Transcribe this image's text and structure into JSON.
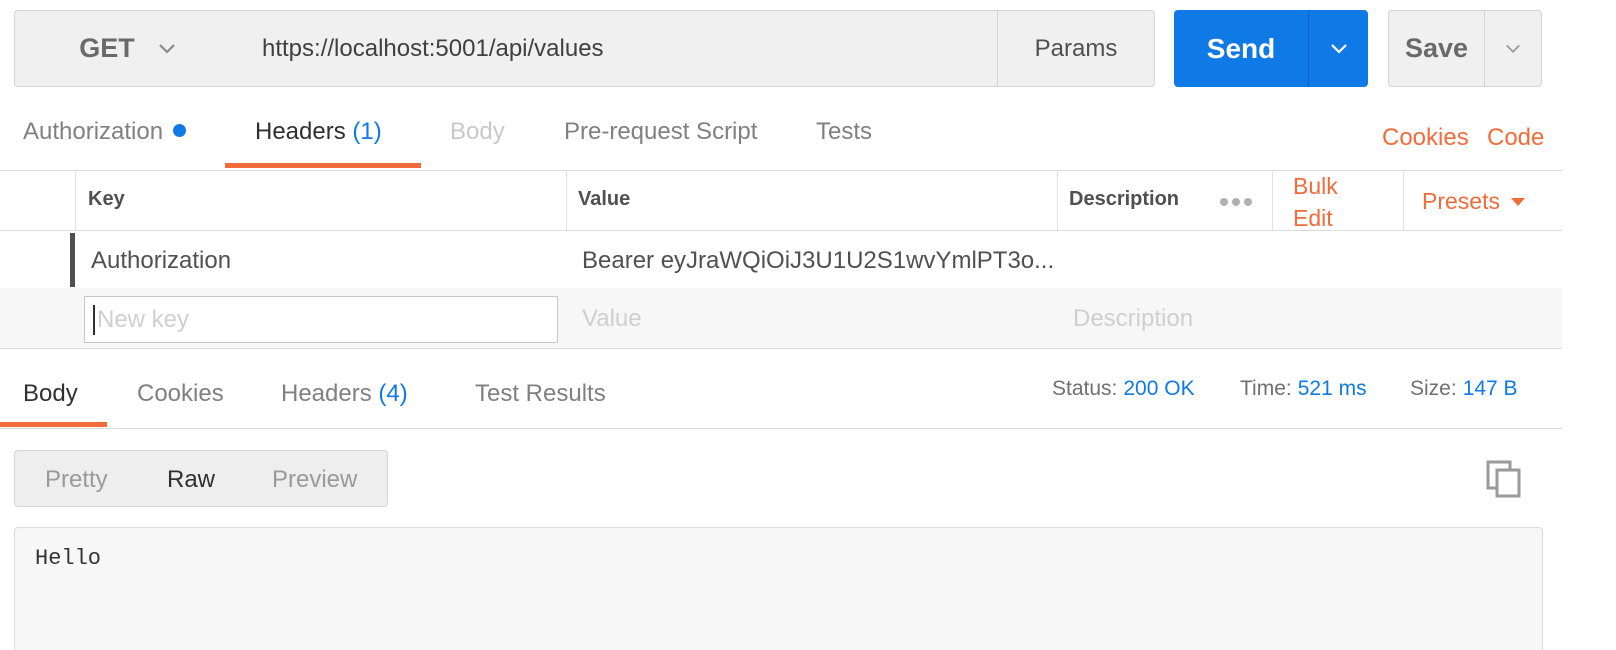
{
  "request": {
    "method": "GET",
    "url": "https://localhost:5001/api/values",
    "params_label": "Params",
    "send_label": "Send",
    "save_label": "Save"
  },
  "request_tabs": {
    "authorization": "Authorization",
    "headers": "Headers",
    "headers_count": "(1)",
    "body": "Body",
    "prerequest": "Pre-request Script",
    "tests": "Tests",
    "cookies_link": "Cookies",
    "code_link": "Code"
  },
  "headers_table": {
    "col_key": "Key",
    "col_value": "Value",
    "col_description": "Description",
    "bulk_edit_line1": "Bulk",
    "bulk_edit_line2": "Edit",
    "presets": "Presets",
    "rows": [
      {
        "key": "Authorization",
        "value": "Bearer eyJraWQiOiJ3U1U2S1wvYmlPT3o...",
        "description": ""
      }
    ],
    "new_row": {
      "key_placeholder": "New key",
      "value_placeholder": "Value",
      "description_placeholder": "Description"
    }
  },
  "response_tabs": {
    "body": "Body",
    "cookies": "Cookies",
    "headers": "Headers",
    "headers_count": "(4)",
    "test_results": "Test Results"
  },
  "response_meta": {
    "status_label": "Status:",
    "status_value": "200 OK",
    "time_label": "Time:",
    "time_value": "521 ms",
    "size_label": "Size:",
    "size_value": "147 B"
  },
  "view_modes": {
    "pretty": "Pretty",
    "raw": "Raw",
    "preview": "Preview",
    "selected": "Raw"
  },
  "response_body": "Hello",
  "colors": {
    "accent_blue": "#0f7ae5",
    "accent_orange": "#f26b3a"
  },
  "icons": [
    "chevron-down-icon",
    "more-dots-icon",
    "caret-down-icon",
    "copy-icon",
    "status-dot-icon"
  ]
}
